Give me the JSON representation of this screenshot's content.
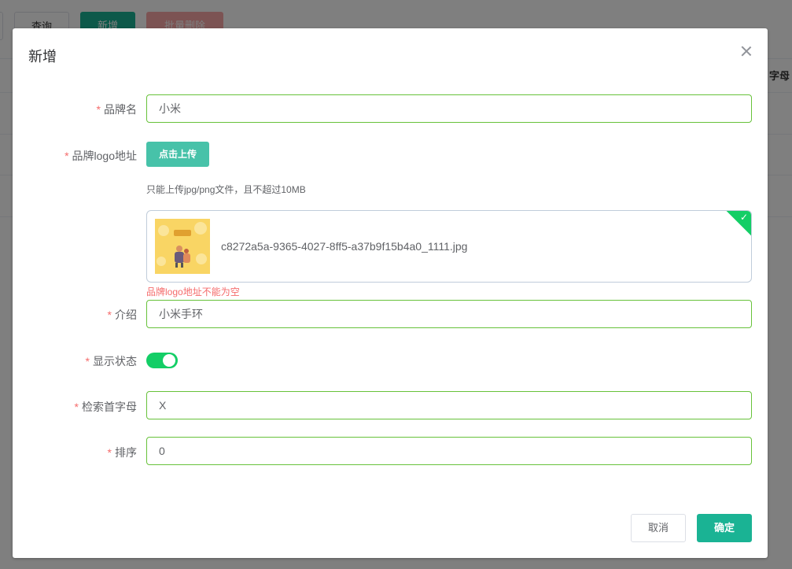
{
  "background": {
    "query_label": "查询",
    "add_label": "新增",
    "batch_delete_label": "批量删除",
    "table_header_fragment": "字母"
  },
  "dialog": {
    "title": "新增",
    "fields": {
      "brand_name": {
        "label": "品牌名",
        "value": "小米"
      },
      "logo": {
        "label": "品牌logo地址",
        "upload_button": "点击上传",
        "tip": "只能上传jpg/png文件，且不超过10MB",
        "file_name": "c8272a5a-9365-4027-8ff5-a37b9f15b4a0_1111.jpg",
        "error": "品牌logo地址不能为空"
      },
      "intro": {
        "label": "介绍",
        "value": "小米手环"
      },
      "show_status": {
        "label": "显示状态",
        "on": true
      },
      "first_letter": {
        "label": "检索首字母",
        "value": "X"
      },
      "sort": {
        "label": "排序",
        "value": "0"
      }
    },
    "footer": {
      "cancel_label": "取消",
      "confirm_label": "确定"
    }
  },
  "icons": {
    "close": "close-icon",
    "check": "check-icon"
  },
  "colors": {
    "primary": "#1ab394",
    "success": "#13ce66",
    "danger": "#f56c6c",
    "valid_border": "#67c23a"
  }
}
